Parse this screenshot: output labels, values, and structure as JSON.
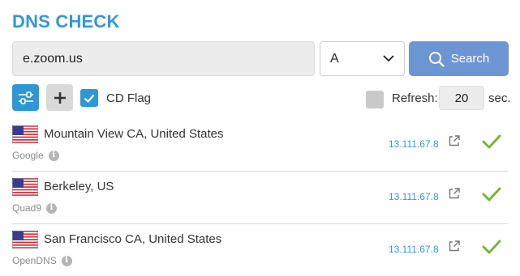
{
  "header": {
    "title": "DNS CHECK"
  },
  "query": {
    "value": "e.zoom.us"
  },
  "record_type": {
    "selected": "A"
  },
  "search": {
    "label": "Search"
  },
  "options": {
    "cd_flag_label": "CD Flag",
    "cd_flag_checked": true,
    "refresh_label": "Refresh:",
    "refresh_checked": false,
    "refresh_value": "20",
    "refresh_unit": "sec."
  },
  "results": [
    {
      "location": "Mountain View CA, United States",
      "provider": "Google",
      "ip": "13.111.67.8",
      "status": "ok"
    },
    {
      "location": "Berkeley, US",
      "provider": "Quad9",
      "ip": "13.111.67.8",
      "status": "ok"
    },
    {
      "location": "San Francisco CA, United States",
      "provider": "OpenDNS",
      "ip": "13.111.67.8",
      "status": "ok"
    }
  ],
  "colors": {
    "accent": "#3399d3",
    "search_button": "#6c96d2",
    "success": "#7bb33a"
  }
}
